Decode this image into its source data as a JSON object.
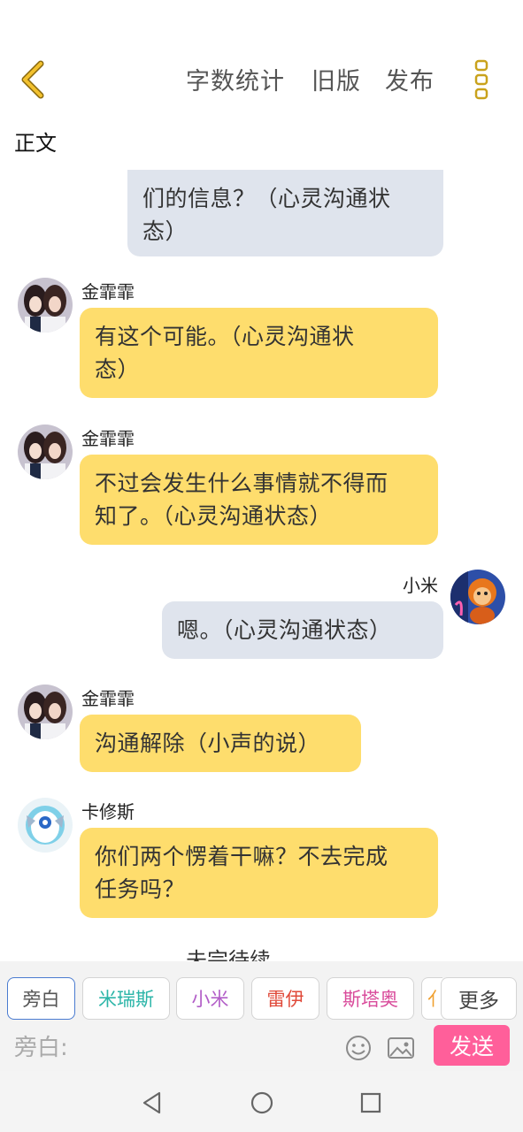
{
  "header": {
    "word_count": "字数统计",
    "old_version": "旧版",
    "publish": "发布"
  },
  "section_label": "正文",
  "messages": [
    {
      "side": "right",
      "text": "们的信息？（心灵沟通状态）",
      "text_line1": "们的信息？（心灵沟通状",
      "text_line2": "态）"
    },
    {
      "side": "left",
      "name": "金霏霏",
      "text_line1": "有这个可能。（心灵沟通状",
      "text_line2": "态）"
    },
    {
      "side": "left",
      "name": "金霏霏",
      "text_line1": "不过会发生什么事情就不得而",
      "text_line2": "知了。（心灵沟通状态）"
    },
    {
      "side": "right",
      "name": "小米",
      "text_line1": "嗯。（心灵沟通状态）"
    },
    {
      "side": "left",
      "name": "金霏霏",
      "text_line1": "沟通解除（小声的说）"
    },
    {
      "side": "left",
      "name": "卡修斯",
      "text_line1": "你们两个愣着干嘛？不去完成",
      "text_line2": "任务吗？"
    }
  ],
  "bottom_partial_text": "未完待续",
  "characters": [
    {
      "label": "旁白",
      "color": "#555555"
    },
    {
      "label": "米瑞斯",
      "color": "#2bb5a8"
    },
    {
      "label": "小米",
      "color": "#b25ec8"
    },
    {
      "label": "雷伊",
      "color": "#e04a3a"
    },
    {
      "label": "斯塔奥",
      "color": "#d94b9b"
    },
    {
      "label": "亻",
      "color": "#f0a030"
    }
  ],
  "more_label": "更多",
  "input": {
    "placeholder": "旁白:"
  },
  "send_label": "发送",
  "colors": {
    "accent_yellow": "#fedd6d",
    "right_bubble": "#dfe4ed",
    "send_pink": "#ff5f9a",
    "back_arrow": "#f2c12e"
  },
  "icons": {
    "back": "chevron-left-icon",
    "more": "vertical-dots-icon",
    "emoji": "smiley-icon",
    "image": "image-icon",
    "nav_back": "triangle-back-icon",
    "nav_home": "circle-home-icon",
    "nav_recent": "square-recent-icon"
  }
}
